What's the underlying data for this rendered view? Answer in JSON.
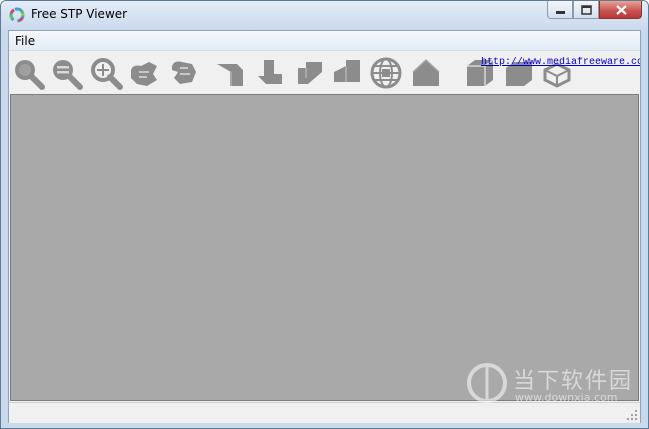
{
  "window": {
    "title": "Free STP Viewer",
    "minimize_icon": "minimize-icon",
    "maximize_icon": "maximize-icon",
    "close_icon": "close-icon"
  },
  "menubar": {
    "items": [
      {
        "label": "File"
      }
    ]
  },
  "toolbar": {
    "buttons": [
      {
        "name": "zoom-icon"
      },
      {
        "name": "zoom-out-icon"
      },
      {
        "name": "zoom-fit-icon"
      },
      {
        "name": "rotate-icon"
      },
      {
        "name": "pan-icon"
      },
      {
        "name": "view-front-icon"
      },
      {
        "name": "view-back-icon"
      },
      {
        "name": "view-left-icon"
      },
      {
        "name": "view-right-icon"
      },
      {
        "name": "view-top-globe-icon"
      },
      {
        "name": "view-home-icon"
      },
      {
        "name": "shaded-box-icon"
      },
      {
        "name": "solid-box-icon"
      },
      {
        "name": "wireframe-box-icon"
      }
    ],
    "link_text": "http://www.mediafreeware.co"
  },
  "watermark": {
    "title": "当下软件园",
    "url": "www.downxia.com"
  },
  "colors": {
    "viewport_bg": "#a9a9a9",
    "icon_gray": "#8c8c8c",
    "link": "#0000cc"
  }
}
